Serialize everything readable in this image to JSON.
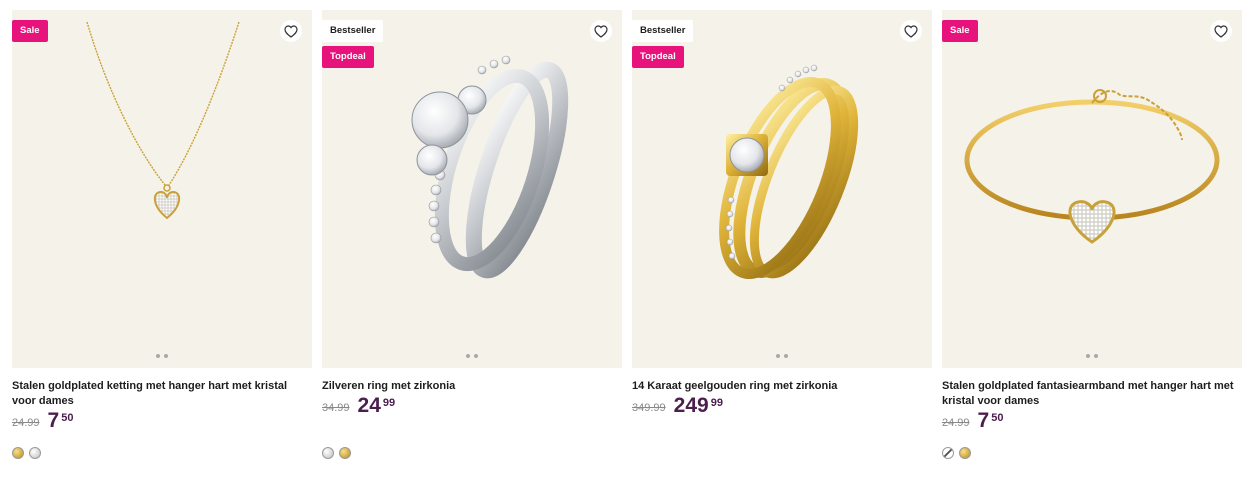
{
  "products": [
    {
      "badges": [
        "Sale"
      ],
      "title": "Stalen goldplated ketting met hanger hart met kristal voor dames",
      "old_price": "24.99",
      "price_main": "7",
      "price_cents": "50",
      "swatches": [
        "gold",
        "silver"
      ],
      "image": "necklace"
    },
    {
      "badges": [
        "Bestseller",
        "Topdeal"
      ],
      "title": "Zilveren ring met zirkonia",
      "old_price": "34.99",
      "price_main": "24",
      "price_cents": "99",
      "swatches": [
        "silver",
        "gold"
      ],
      "image": "silver-ring"
    },
    {
      "badges": [
        "Bestseller",
        "Topdeal"
      ],
      "title": "14 Karaat geelgouden ring met zirkonia",
      "old_price": "349.99",
      "price_main": "249",
      "price_cents": "99",
      "swatches": [],
      "image": "gold-ring"
    },
    {
      "badges": [
        "Sale"
      ],
      "title": "Stalen goldplated fantasiearmband met hanger hart met kristal voor dames",
      "old_price": "24.99",
      "price_main": "7",
      "price_cents": "50",
      "swatches": [
        "slash",
        "gold"
      ],
      "image": "bracelet"
    }
  ],
  "colors": {
    "sale_badge": "#e8127c",
    "price": "#4b1e4e",
    "media_bg": "#f5f3e9"
  },
  "icons": {
    "wishlist": "heart-outline-icon"
  }
}
